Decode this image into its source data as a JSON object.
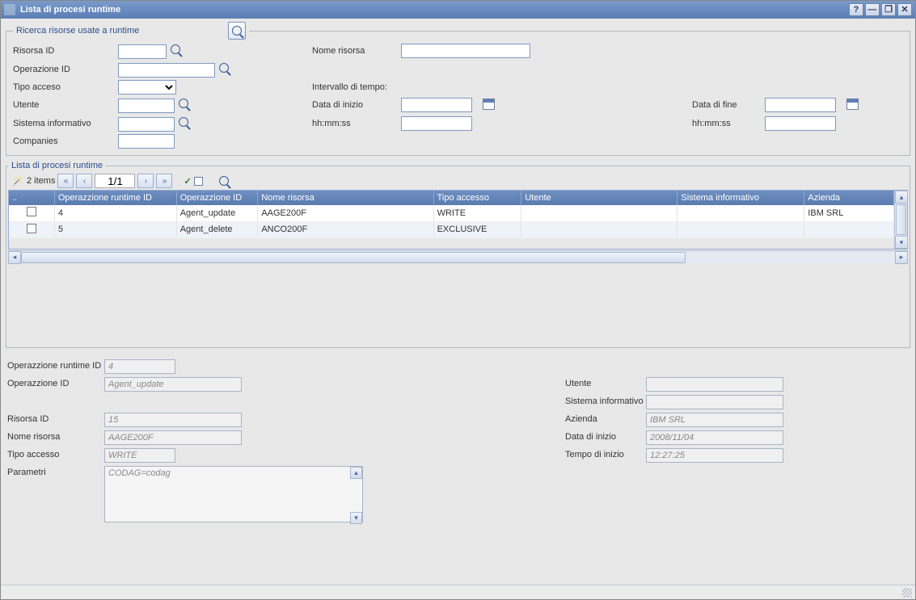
{
  "window": {
    "title": "Lista di procesi runtime"
  },
  "search": {
    "legend": "Ricerca risorse usate a runtime",
    "labels": {
      "risorsa_id": "Risorsa ID",
      "operazione_id": "Operazione ID",
      "tipo_acceso": "Tipo acceso",
      "utente": "Utente",
      "sistema_info": "Sistema informativo",
      "companies": "Companies",
      "nome_risorsa": "Nome risorsa",
      "intervallo": "Intervallo di tempo:",
      "data_inizio": "Data di inizio",
      "hhmmss": "hh:mm:ss",
      "data_fine": "Data di fine"
    }
  },
  "list": {
    "legend": "Lista di procesi runtime",
    "items_label": "2 items",
    "page": "1/1",
    "columns": {
      "sel": "..",
      "op_runtime_id": "Operazzione runtime ID",
      "op_id": "Operazzione ID",
      "nome_risorsa": "Nome risorsa",
      "tipo_accesso": "Tipo accesso",
      "utente": "Utente",
      "sistema_info": "Sistema informativo",
      "azienda": "Azienda"
    },
    "rows": [
      {
        "op_runtime_id": "4",
        "op_id": "Agent_update",
        "nome_risorsa": "AAGE200F",
        "tipo_accesso": "WRITE",
        "utente": "",
        "sistema_info": "",
        "azienda": "IBM SRL"
      },
      {
        "op_runtime_id": "5",
        "op_id": "Agent_delete",
        "nome_risorsa": "ANCO200F",
        "tipo_accesso": "EXCLUSIVE",
        "utente": "",
        "sistema_info": "",
        "azienda": ""
      }
    ]
  },
  "detail": {
    "labels": {
      "op_runtime_id": "Operazzione runtime ID",
      "op_id": "Operazzione ID",
      "risorsa_id": "Risorsa ID",
      "nome_risorsa": "Nome risorsa",
      "tipo_accesso": "Tipo accesso",
      "parametri": "Parametri",
      "utente": "Utente",
      "sistema_info": "Sistema informativo",
      "azienda": "Azienda",
      "data_inizio": "Data di inizio",
      "tempo_inizio": "Tempo di inizio"
    },
    "values": {
      "op_runtime_id": "4",
      "op_id": "Agent_update",
      "risorsa_id": "15",
      "nome_risorsa": "AAGE200F",
      "tipo_accesso": "WRITE",
      "parametri": "CODAG=codag",
      "utente": "",
      "sistema_info": "",
      "azienda": "IBM SRL",
      "data_inizio": "2008/11/04",
      "tempo_inizio": "12:27:25"
    }
  }
}
